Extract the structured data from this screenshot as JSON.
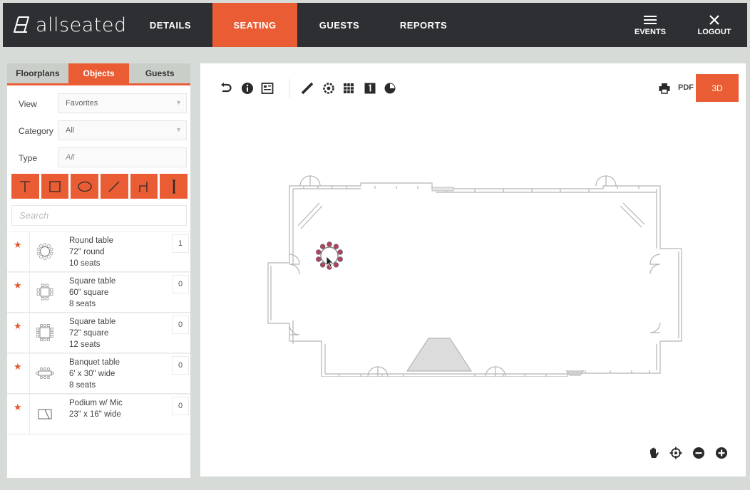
{
  "brand": {
    "name": "allseated"
  },
  "nav": {
    "details": "DETAILS",
    "seating": "SEATING",
    "guests": "GUESTS",
    "reports": "REPORTS",
    "events": "EVENTS",
    "logout": "LOGOUT"
  },
  "panel": {
    "tabs": [
      "Floorplans",
      "Objects",
      "Guests"
    ],
    "active_tab": "Objects",
    "filters": {
      "view_label": "View",
      "view_value": "Favorites",
      "category_label": "Category",
      "category_value": "All",
      "type_label": "Type",
      "type_value": "All"
    },
    "tools": [
      "text-tool-icon",
      "rectangle-tool-icon",
      "ellipse-tool-icon",
      "line-tool-icon",
      "wall-tool-icon",
      "pillar-tool-icon"
    ],
    "search_placeholder": "Search",
    "items": [
      {
        "line1": "Round table",
        "line2": "72\" round",
        "line3": "10 seats",
        "count": "1",
        "icon": "round-table-icon"
      },
      {
        "line1": "Square table",
        "line2": "60\" square",
        "line3": "8 seats",
        "count": "0",
        "icon": "square-table-icon"
      },
      {
        "line1": "Square table",
        "line2": "72\" square",
        "line3": "12 seats",
        "count": "0",
        "icon": "square-table-icon"
      },
      {
        "line1": "Banquet table",
        "line2": "6' x 30\" wide",
        "line3": "8 seats",
        "count": "0",
        "icon": "banquet-table-icon"
      },
      {
        "line1": "Podium w/ Mic",
        "line2": "23\" x 16\" wide",
        "line3": "",
        "count": "0",
        "icon": "podium-icon"
      }
    ]
  },
  "canvas": {
    "pdf_label": "PDF",
    "view3d_label": "3D",
    "toolbar_icons": [
      "undo-icon",
      "info-icon",
      "layout-icon",
      "ruler-icon",
      "settings-icon",
      "grid-icon",
      "number-icon",
      "pie-icon",
      "print-icon"
    ],
    "bottom_icons": [
      "pan-hand-icon",
      "center-target-icon",
      "zoom-out-icon",
      "zoom-in-icon"
    ]
  },
  "colors": {
    "accent": "#ea5d34",
    "nav_bg": "#2e2f33",
    "page_bg": "#d7dbd8",
    "tab_bg": "#c9cec9"
  }
}
